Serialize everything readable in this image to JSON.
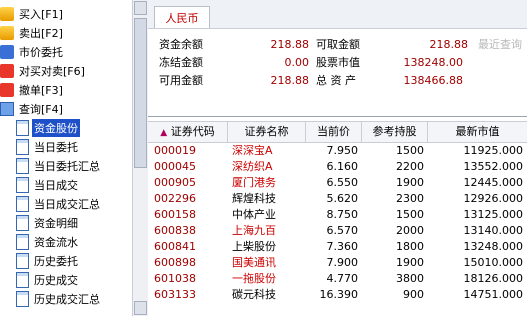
{
  "tree": [
    {
      "label": "买入[F1]",
      "icon": "buy-icon",
      "kind": "top"
    },
    {
      "label": "卖出[F2]",
      "icon": "sell-icon",
      "kind": "top"
    },
    {
      "label": "市价委托",
      "icon": "market-order-icon",
      "kind": "top"
    },
    {
      "label": "对买对卖[F6]",
      "icon": "cross-trade-icon",
      "kind": "top"
    },
    {
      "label": "撤单[F3]",
      "icon": "cancel-order-icon",
      "kind": "top"
    },
    {
      "label": "查询[F4]",
      "icon": "folder-open-icon",
      "kind": "top"
    },
    {
      "label": "资金股份",
      "icon": "document-icon",
      "kind": "child",
      "selected": true
    },
    {
      "label": "当日委托",
      "icon": "document-icon",
      "kind": "child"
    },
    {
      "label": "当日委托汇总",
      "icon": "document-icon",
      "kind": "child"
    },
    {
      "label": "当日成交",
      "icon": "document-icon",
      "kind": "child"
    },
    {
      "label": "当日成交汇总",
      "icon": "document-icon",
      "kind": "child"
    },
    {
      "label": "资金明细",
      "icon": "document-icon",
      "kind": "child"
    },
    {
      "label": "资金流水",
      "icon": "document-icon",
      "kind": "child"
    },
    {
      "label": "历史委托",
      "icon": "document-icon",
      "kind": "child"
    },
    {
      "label": "历史成交",
      "icon": "document-icon",
      "kind": "child"
    },
    {
      "label": "历史成交汇总",
      "icon": "document-icon",
      "kind": "child"
    }
  ],
  "tab": {
    "label": "人民币"
  },
  "summary": {
    "balance_label": "资金余额",
    "balance": "218.88",
    "withdrawable_label": "可取金额",
    "withdrawable": "218.88",
    "latest_query_hint": "最近查询",
    "frozen_label": "冻结金额",
    "frozen": "0.00",
    "stock_value_label": "股票市值",
    "stock_value": "138248.00",
    "available_label": "可用金额",
    "available": "218.88",
    "total_assets_label": "总 资 产",
    "total_assets": "138466.88"
  },
  "table": {
    "sort_indicator": "▲",
    "columns": [
      "证券代码",
      "证券名称",
      "当前价",
      "参考持股",
      "最新市值"
    ],
    "rows": [
      {
        "code": "000019",
        "name": "深深宝A",
        "price": "7.950",
        "shares": "1500",
        "value": "11925.000"
      },
      {
        "code": "000045",
        "name": "深纺织A",
        "price": "6.160",
        "shares": "2200",
        "value": "13552.000"
      },
      {
        "code": "000905",
        "name": "厦门港务",
        "price": "6.550",
        "shares": "1900",
        "value": "12445.000"
      },
      {
        "code": "002296",
        "name": "辉煌科技",
        "price": "5.620",
        "shares": "2300",
        "value": "12926.000"
      },
      {
        "code": "600158",
        "name": "中体产业",
        "price": "8.750",
        "shares": "1500",
        "value": "13125.000"
      },
      {
        "code": "600838",
        "name": "上海九百",
        "price": "6.570",
        "shares": "2000",
        "value": "13140.000"
      },
      {
        "code": "600841",
        "name": "上柴股份",
        "price": "7.360",
        "shares": "1800",
        "value": "13248.000"
      },
      {
        "code": "600898",
        "name": "国美通讯",
        "price": "7.900",
        "shares": "1900",
        "value": "15010.000"
      },
      {
        "code": "601038",
        "name": "一拖股份",
        "price": "4.770",
        "shares": "3800",
        "value": "18126.000"
      },
      {
        "code": "603133",
        "name": "碳元科技",
        "price": "16.390",
        "shares": "900",
        "value": "14751.000"
      }
    ]
  },
  "colors": {
    "accent": "#c00000",
    "selection": "#1e50c8",
    "red_name": "#cc0000"
  }
}
